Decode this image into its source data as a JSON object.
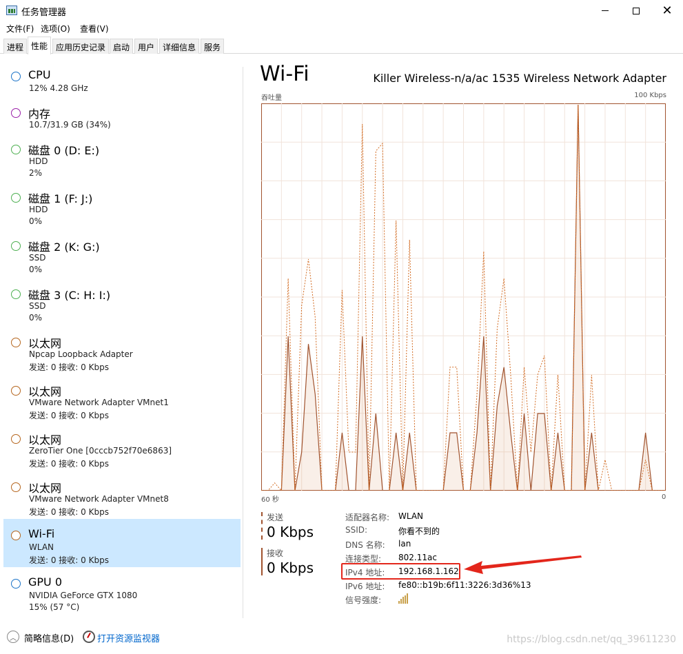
{
  "window": {
    "title": "任务管理器",
    "minimize": "–",
    "maximize": "□",
    "close": "✕"
  },
  "menu": {
    "items": [
      "文件(F)",
      "选项(O)",
      "查看(V)"
    ]
  },
  "tabs": [
    "进程",
    "性能",
    "应用历史记录",
    "启动",
    "用户",
    "详细信息",
    "服务"
  ],
  "active_tab": "性能",
  "sidebar": {
    "items": [
      {
        "title": "CPU",
        "sub1": "12% 4.28 GHz",
        "sub2": "",
        "color": "#1a73c8"
      },
      {
        "title": "内存",
        "sub1": "10.7/31.9 GB (34%)",
        "sub2": "",
        "color": "#9a1fa8"
      },
      {
        "title": "磁盘 0 (D: E:)",
        "sub1": "HDD",
        "sub2": "2%",
        "color": "#4caf50"
      },
      {
        "title": "磁盘 1 (F: J:)",
        "sub1": "HDD",
        "sub2": "0%",
        "color": "#4caf50"
      },
      {
        "title": "磁盘 2 (K: G:)",
        "sub1": "SSD",
        "sub2": "0%",
        "color": "#4caf50"
      },
      {
        "title": "磁盘 3 (C: H: I:)",
        "sub1": "SSD",
        "sub2": "0%",
        "color": "#4caf50"
      },
      {
        "title": "以太网",
        "sub1": "Npcap Loopback Adapter",
        "sub2": "发送: 0 接收: 0 Kbps",
        "color": "#b5651d"
      },
      {
        "title": "以太网",
        "sub1": "VMware Network Adapter VMnet1",
        "sub2": "发送: 0 接收: 0 Kbps",
        "color": "#b5651d"
      },
      {
        "title": "以太网",
        "sub1": "ZeroTier One [0cccb752f70e6863]",
        "sub2": "发送: 0 接收: 0 Kbps",
        "color": "#b5651d"
      },
      {
        "title": "以太网",
        "sub1": "VMware Network Adapter VMnet8",
        "sub2": "发送: 0 接收: 0 Kbps",
        "color": "#b5651d"
      },
      {
        "title": "Wi-Fi",
        "sub1": "WLAN",
        "sub2": "发送: 0 接收: 0 Kbps",
        "color": "#b5651d"
      },
      {
        "title": "GPU 0",
        "sub1": "NVIDIA GeForce GTX 1080",
        "sub2": "15% (57 °C)",
        "color": "#1a73c8"
      }
    ],
    "selected_index": 10
  },
  "main": {
    "title": "Wi-Fi",
    "adapter": "Killer Wireless-n/a/ac 1535 Wireless Network Adapter",
    "chart_label_left": "吞吐量",
    "chart_label_right": "100 Kbps",
    "axis_left": "60 秒",
    "axis_right": "0",
    "send_label": "发送",
    "send_value": "0 Kbps",
    "recv_label": "接收",
    "recv_value": "0 Kbps",
    "info": [
      {
        "key": "适配器名称:",
        "value": "WLAN"
      },
      {
        "key": "SSID:",
        "value": "你看不到的"
      },
      {
        "key": "DNS 名称:",
        "value": "lan"
      },
      {
        "key": "连接类型:",
        "value": "802.11ac"
      },
      {
        "key": "IPv4 地址:",
        "value": "192.168.1.162"
      },
      {
        "key": "IPv6 地址:",
        "value": "fe80::b19b:6f11:3226:3d36%13"
      },
      {
        "key": "信号强度:",
        "value": ""
      }
    ],
    "accent_color": "#a0522d"
  },
  "footer": {
    "brief": "简略信息(D)",
    "monitor": "打开资源监视器"
  },
  "watermark": "https://blog.csdn.net/qq_39611230",
  "chart_data": {
    "type": "line",
    "title": "",
    "ylim": [
      0,
      100
    ],
    "series": [
      {
        "name": "发送",
        "values": [
          0,
          0,
          2,
          0,
          55,
          0,
          48,
          60,
          45,
          0,
          0,
          0,
          52,
          10,
          10,
          95,
          0,
          88,
          90,
          0,
          70,
          0,
          65,
          0,
          0,
          0,
          0,
          0,
          32,
          32,
          0,
          0,
          25,
          62,
          0,
          42,
          55,
          30,
          0,
          32,
          10,
          30,
          35,
          0,
          30,
          0,
          0,
          100,
          0,
          30,
          0,
          8,
          0,
          0,
          0,
          0,
          0,
          8,
          0,
          0,
          0
        ]
      },
      {
        "name": "接收",
        "values": [
          0,
          0,
          0,
          0,
          40,
          0,
          10,
          38,
          25,
          0,
          0,
          0,
          15,
          0,
          0,
          40,
          0,
          20,
          0,
          0,
          15,
          0,
          15,
          0,
          0,
          0,
          0,
          0,
          15,
          15,
          0,
          0,
          15,
          40,
          0,
          22,
          32,
          15,
          0,
          20,
          0,
          20,
          20,
          0,
          15,
          0,
          0,
          100,
          0,
          15,
          0,
          0,
          0,
          0,
          0,
          0,
          0,
          15,
          0,
          0,
          0
        ]
      }
    ]
  }
}
